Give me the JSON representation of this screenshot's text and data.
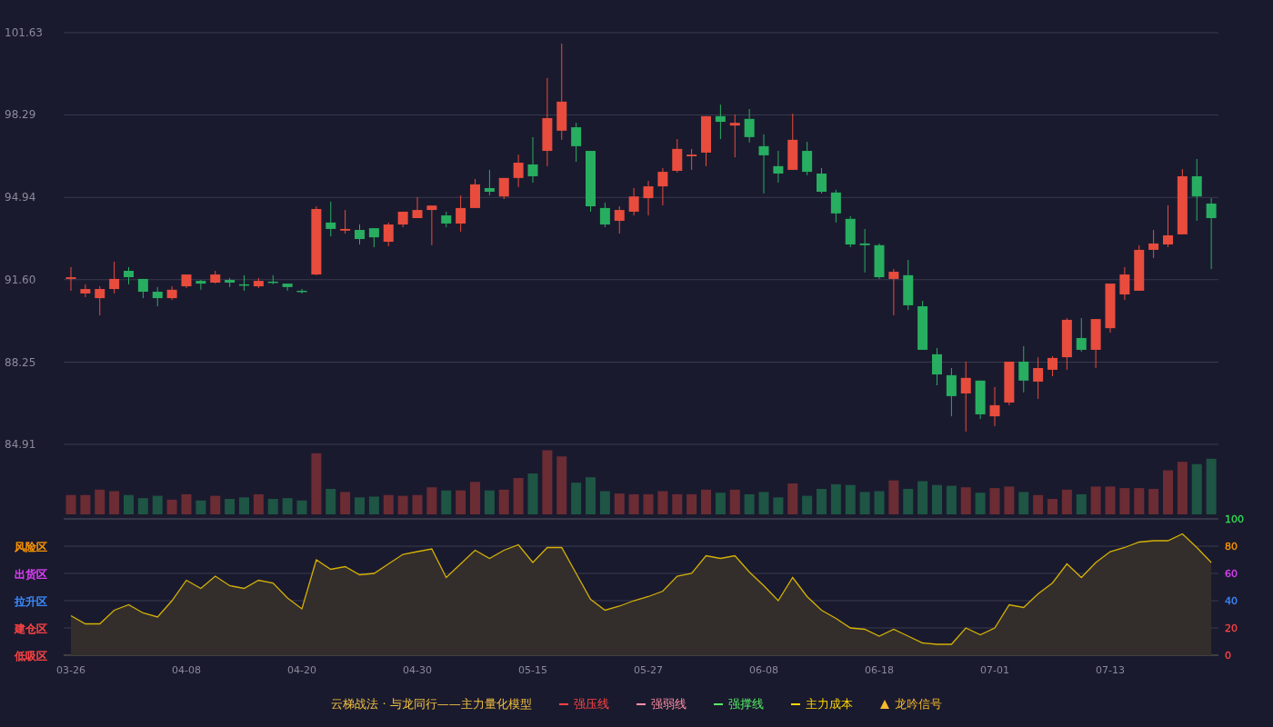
{
  "price_chart": {
    "chart_data": {
      "type": "candlestick",
      "grid": true,
      "ylim": [
        84.91,
        101.63
      ],
      "yticks": [
        {
          "value": 101.63,
          "label": "101.63"
        },
        {
          "value": 98.29,
          "label": "98.29"
        },
        {
          "value": 94.94,
          "label": "94.94"
        },
        {
          "value": 91.6,
          "label": "91.60"
        },
        {
          "value": 88.25,
          "label": "88.25"
        },
        {
          "value": 84.91,
          "label": "84.91"
        }
      ],
      "ohlc": [
        [
          91.63,
          92.11,
          91.15,
          91.7
        ],
        [
          91.04,
          91.41,
          90.89,
          91.22
        ],
        [
          90.85,
          91.33,
          90.15,
          91.22
        ],
        [
          91.22,
          92.33,
          91.04,
          91.63
        ],
        [
          91.96,
          92.11,
          91.41,
          91.7
        ],
        [
          91.63,
          91.63,
          90.85,
          91.11
        ],
        [
          91.11,
          91.3,
          90.52,
          90.85
        ],
        [
          90.85,
          91.33,
          90.78,
          91.19
        ],
        [
          91.33,
          91.81,
          91.26,
          91.81
        ],
        [
          91.55,
          91.59,
          91.19,
          91.44
        ],
        [
          91.48,
          91.96,
          91.44,
          91.81
        ],
        [
          91.59,
          91.67,
          91.3,
          91.48
        ],
        [
          91.41,
          91.78,
          91.15,
          91.37
        ],
        [
          91.33,
          91.67,
          91.26,
          91.55
        ],
        [
          91.52,
          91.78,
          91.41,
          91.48
        ],
        [
          91.44,
          91.44,
          91.15,
          91.3
        ],
        [
          91.15,
          91.22,
          91.04,
          91.11
        ],
        [
          91.81,
          94.58,
          91.78,
          94.47
        ],
        [
          93.92,
          94.77,
          93.36,
          93.66
        ],
        [
          93.59,
          94.43,
          93.47,
          93.66
        ],
        [
          93.62,
          93.84,
          93.03,
          93.25
        ],
        [
          93.69,
          93.69,
          92.92,
          93.32
        ],
        [
          93.14,
          93.92,
          92.96,
          93.84
        ],
        [
          93.84,
          94.36,
          93.73,
          94.36
        ],
        [
          94.1,
          94.95,
          94.1,
          94.43
        ],
        [
          94.43,
          94.61,
          93.0,
          94.61
        ],
        [
          94.21,
          94.36,
          93.73,
          93.88
        ],
        [
          93.88,
          95.02,
          93.55,
          94.51
        ],
        [
          94.51,
          95.69,
          94.51,
          95.47
        ],
        [
          95.32,
          96.06,
          95.02,
          95.17
        ],
        [
          94.98,
          95.73,
          94.87,
          95.73
        ],
        [
          95.73,
          96.68,
          95.36,
          96.35
        ],
        [
          96.28,
          97.39,
          95.54,
          95.8
        ],
        [
          96.83,
          99.79,
          96.21,
          98.16
        ],
        [
          97.65,
          101.19,
          97.28,
          98.83
        ],
        [
          97.79,
          97.97,
          96.39,
          97.02
        ],
        [
          96.83,
          96.83,
          94.36,
          94.58
        ],
        [
          94.51,
          94.73,
          93.73,
          93.84
        ],
        [
          93.99,
          94.58,
          93.47,
          94.43
        ],
        [
          94.36,
          95.32,
          94.21,
          94.98
        ],
        [
          94.91,
          95.61,
          94.21,
          95.39
        ],
        [
          95.39,
          96.13,
          94.62,
          95.98
        ],
        [
          96.02,
          97.31,
          95.95,
          96.91
        ],
        [
          96.61,
          96.91,
          96.06,
          96.68
        ],
        [
          96.76,
          98.24,
          96.21,
          98.24
        ],
        [
          98.24,
          98.71,
          97.31,
          98.01
        ],
        [
          97.86,
          98.31,
          96.57,
          97.97
        ],
        [
          98.13,
          98.53,
          97.17,
          97.39
        ],
        [
          97.02,
          97.5,
          95.1,
          96.65
        ],
        [
          96.21,
          96.83,
          95.54,
          95.91
        ],
        [
          96.06,
          98.34,
          96.06,
          97.28
        ],
        [
          96.83,
          97.2,
          95.84,
          95.98
        ],
        [
          95.91,
          96.13,
          95.1,
          95.17
        ],
        [
          95.14,
          95.25,
          93.92,
          94.29
        ],
        [
          94.07,
          94.18,
          92.92,
          93.03
        ],
        [
          93.07,
          93.66,
          91.89,
          93.0
        ],
        [
          93.0,
          93.07,
          91.63,
          91.7
        ],
        [
          91.63,
          92.03,
          90.15,
          91.92
        ],
        [
          91.78,
          92.4,
          90.37,
          90.56
        ],
        [
          90.52,
          90.74,
          88.75,
          88.75
        ],
        [
          88.57,
          88.82,
          87.31,
          87.75
        ],
        [
          87.72,
          88.01,
          86.05,
          86.87
        ],
        [
          86.98,
          88.27,
          85.43,
          87.61
        ],
        [
          87.5,
          87.5,
          85.94,
          86.13
        ],
        [
          86.05,
          87.24,
          85.65,
          86.5
        ],
        [
          86.61,
          88.27,
          86.5,
          88.27
        ],
        [
          88.27,
          88.9,
          87.02,
          87.5
        ],
        [
          87.46,
          88.45,
          86.76,
          88.01
        ],
        [
          87.94,
          88.49,
          87.68,
          88.42
        ],
        [
          88.45,
          90.04,
          87.94,
          89.97
        ],
        [
          89.23,
          90.04,
          88.68,
          88.75
        ],
        [
          88.75,
          90.0,
          88.01,
          90.0
        ],
        [
          89.63,
          91.44,
          89.45,
          91.44
        ],
        [
          91.0,
          92.11,
          90.78,
          91.81
        ],
        [
          91.15,
          93.0,
          91.15,
          92.81
        ],
        [
          92.81,
          93.62,
          92.48,
          93.07
        ],
        [
          93.03,
          94.62,
          92.92,
          93.4
        ],
        [
          93.44,
          96.09,
          93.44,
          95.8
        ],
        [
          95.8,
          96.5,
          93.99,
          94.98
        ],
        [
          94.69,
          94.91,
          92.03,
          94.1
        ]
      ]
    }
  },
  "indicator": {
    "zones": [
      {
        "label": "风险区",
        "color": "#ff9800"
      },
      {
        "label": "出货区",
        "color": "#e040fb"
      },
      {
        "label": "拉升区",
        "color": "#3d8bfd"
      },
      {
        "label": "建仓区",
        "color": "#ff4444"
      },
      {
        "label": "低吸区",
        "color": "#ff4444"
      }
    ],
    "right_axis": [
      {
        "color": "#ff4444"
      },
      {
        "color": "#ff4444"
      },
      {
        "color": "#3d8bfd"
      },
      {
        "color": "#e040fb"
      },
      {
        "color": "#ff9800"
      },
      {
        "color": "#33dd55"
      }
    ],
    "chart_data": {
      "type": "area",
      "grid": true,
      "ylim": [
        0,
        100
      ],
      "yticks": [
        0,
        20,
        40,
        60,
        80,
        100
      ],
      "categories": [
        "03-26",
        null,
        null,
        null,
        null,
        null,
        null,
        null,
        "04-08",
        null,
        null,
        null,
        null,
        null,
        null,
        null,
        "04-20",
        null,
        null,
        null,
        null,
        null,
        null,
        null,
        "04-30",
        null,
        null,
        null,
        null,
        null,
        null,
        null,
        "05-15",
        null,
        null,
        null,
        null,
        null,
        null,
        null,
        "05-27",
        null,
        null,
        null,
        null,
        null,
        null,
        null,
        "06-08",
        null,
        null,
        null,
        null,
        null,
        null,
        null,
        "06-18",
        null,
        null,
        null,
        null,
        null,
        null,
        null,
        "07-01",
        null,
        null,
        null,
        null,
        null,
        null,
        null,
        "07-13",
        null,
        null,
        null,
        null,
        null,
        null,
        null
      ],
      "series": [
        {
          "color": "#d4b106",
          "values": [
            29,
            23,
            23,
            33,
            37,
            31,
            28,
            40,
            55,
            49,
            58,
            51,
            49,
            55,
            53,
            42,
            34,
            70,
            63,
            65,
            59,
            60,
            67,
            74,
            76,
            78,
            57,
            67,
            77,
            71,
            77,
            81,
            68,
            79,
            79,
            60,
            41,
            33,
            36,
            40,
            43,
            47,
            58,
            60,
            73,
            71,
            73,
            61,
            51,
            40,
            57,
            43,
            33,
            27,
            20,
            19,
            14,
            19,
            14,
            9,
            8,
            8,
            20,
            15,
            20,
            37,
            35,
            45,
            53,
            67,
            57,
            68,
            76,
            79,
            83,
            84,
            84,
            89,
            79,
            68
          ]
        }
      ]
    }
  },
  "legend": {
    "title": "云梯战法 · 与龙同行——主力量化模型",
    "items": [
      {
        "kind": "solid",
        "label": "强压线",
        "color": "#ff4444"
      },
      {
        "kind": "dashed",
        "label": "强弱线",
        "color": "#ff8fa3"
      },
      {
        "kind": "solid",
        "label": "强撑线",
        "color": "#55ee66"
      },
      {
        "kind": "dashed",
        "label": "主力成本",
        "color": "#ffd700"
      },
      {
        "kind": "triangle",
        "label": "龙吟信号",
        "color": "#f5b82e"
      }
    ]
  }
}
